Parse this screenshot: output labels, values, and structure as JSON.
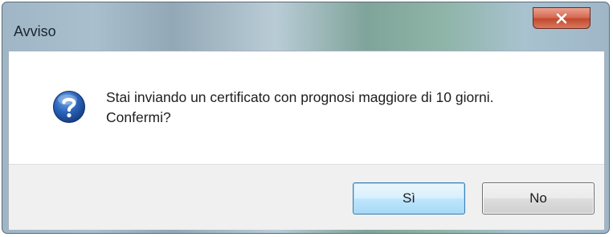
{
  "dialog": {
    "title": "Avviso",
    "close_icon": "close-icon",
    "icon": "question-icon",
    "message_line1": "Stai inviando un certificato con prognosi maggiore di 10 giorni.",
    "message_line2": "Confermi?",
    "buttons": {
      "yes_label": "Sì",
      "no_label": "No"
    }
  },
  "colors": {
    "close_button": "#c94f35",
    "default_button_border": "#3c7fb1",
    "question_icon": "#2257a6"
  }
}
